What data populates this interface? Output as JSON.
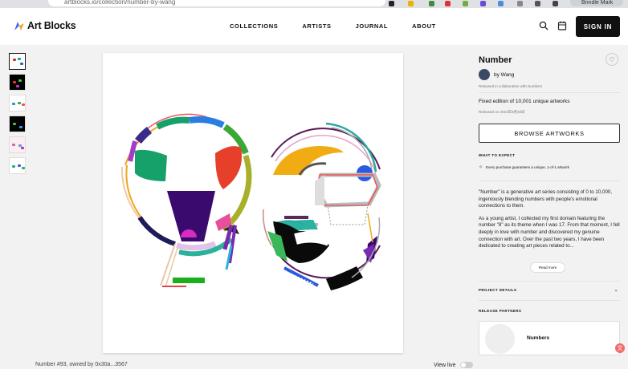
{
  "browser": {
    "url": "artblocks.io/collection/number-by-wang",
    "profile": "Brindle Mark"
  },
  "brand": {
    "name": "Art Blocks",
    "accent": "#111111"
  },
  "nav": [
    {
      "label": "COLLECTIONS"
    },
    {
      "label": "ARTISTS"
    },
    {
      "label": "JOURNAL"
    },
    {
      "label": "ABOUT"
    }
  ],
  "header": {
    "signin_label": "SIGN IN",
    "icons": [
      "search-icon",
      "calendar-icon"
    ]
  },
  "artwork": {
    "owner_text": "Number #93, owned by 0x30a...3567",
    "view_live_label": "View live",
    "view_live_on": false,
    "thumbnail_count": 6
  },
  "project": {
    "title": "Number",
    "artist_line": "by Wang",
    "collab_note": "Released in collaboration with Numbers",
    "edition": "Fixed edition of 10,001 unique artworks",
    "released": "Released on 2024年8月28日",
    "browse_label": "BROWSE ARTWORKS",
    "what_to_expect_label": "WHAT TO EXPECT",
    "guarantee": "Every purchase guarantees a unique, 1-of-1 artwork",
    "description": [
      "\"Number\" is a generative art series consisting of 0 to 10,000, ingeniously blending numbers with people's emotional connections to them.",
      "As a young artist, I collected my first domain featuring the number \"8\" as its theme when I was 17. From that moment, I fell deeply in love with number and discovered my genuine connection with art. Over the past two years, I have been dedicated to creating art pieces related to..."
    ],
    "read_more_label": "Read more",
    "project_details_label": "PROJECT DETAILS",
    "release_partners_label": "RELEASE PARTNERS",
    "partner_name": "Numbers"
  }
}
